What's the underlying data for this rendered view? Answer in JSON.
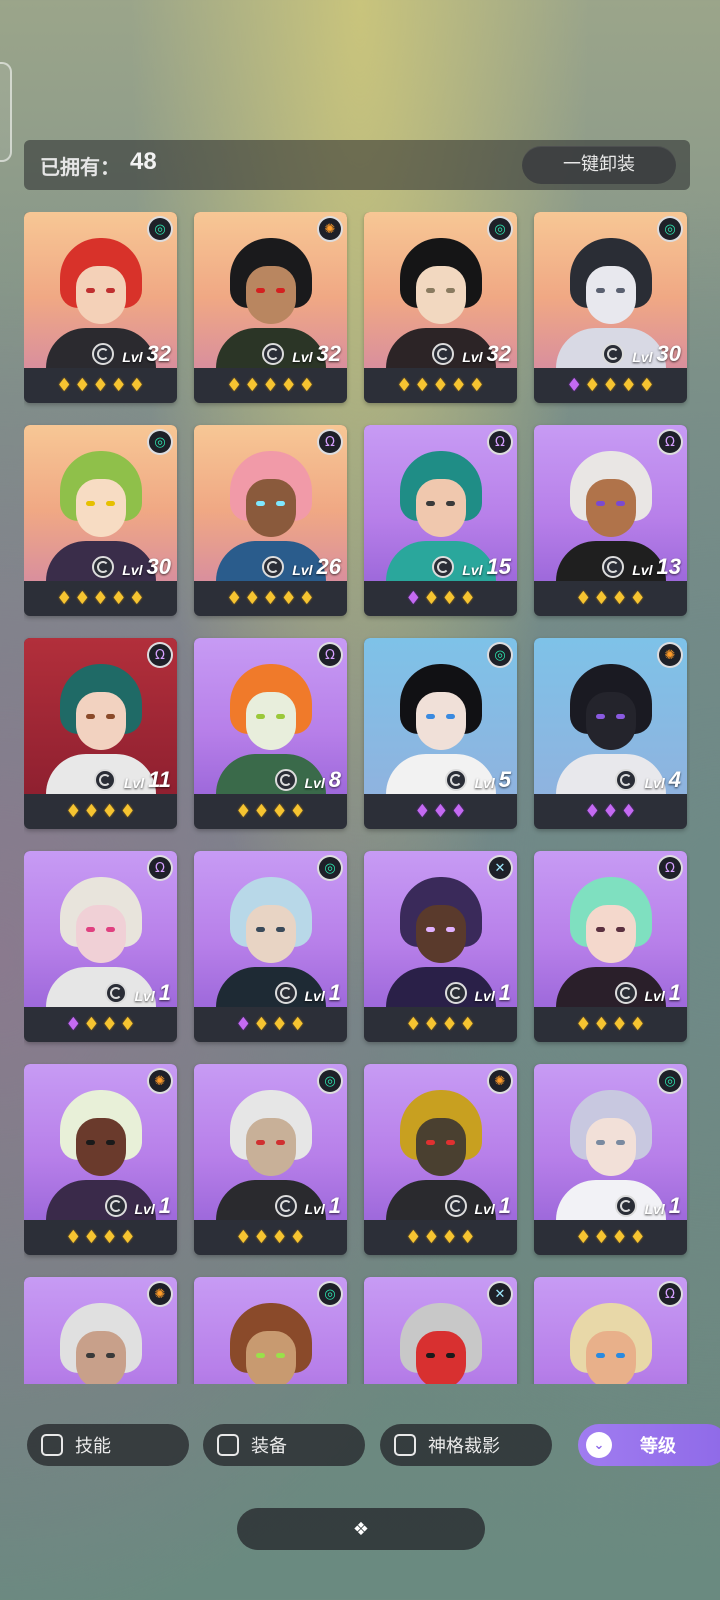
{
  "header": {
    "owned_label": "已拥有：",
    "owned_count": "48",
    "unequip_all_label": "一键卸装"
  },
  "heroes": [
    {
      "level_prefix": "Lvl",
      "level": "32",
      "element": "wind-icon",
      "bg": "orange",
      "hair": "#d8322a",
      "skin": "#f4d1b8",
      "body": "#2b2a2f",
      "eyes": "#c03030",
      "gems": [
        "gold",
        "gold",
        "gold",
        "gold",
        "gold"
      ]
    },
    {
      "level_prefix": "Lvl",
      "level": "32",
      "element": "sun-icon",
      "bg": "orange",
      "hair": "#1a1a1c",
      "skin": "#b98660",
      "body": "#2b3526",
      "eyes": "#d42020",
      "gems": [
        "gold",
        "gold",
        "gold",
        "gold",
        "gold"
      ]
    },
    {
      "level_prefix": "Lvl",
      "level": "32",
      "element": "wind-icon",
      "bg": "orange",
      "hair": "#151516",
      "skin": "#f2d8c0",
      "body": "#2c2426",
      "eyes": "#8a7b60",
      "gems": [
        "gold",
        "gold",
        "gold",
        "gold",
        "gold"
      ]
    },
    {
      "level_prefix": "Lvl",
      "level": "30",
      "element": "wind-icon",
      "bg": "orange",
      "hair": "#2a2d35",
      "skin": "#e8e8ee",
      "body": "#d8d9e4",
      "eyes": "#5a6070",
      "gems": [
        "purple",
        "gold",
        "gold",
        "gold",
        "gold"
      ]
    },
    {
      "level_prefix": "Lvl",
      "level": "30",
      "element": "wind-icon",
      "bg": "orange",
      "hair": "#8fc04a",
      "skin": "#f7dcc3",
      "body": "#3a2d4a",
      "eyes": "#e6c000",
      "gems": [
        "gold",
        "gold",
        "gold",
        "gold",
        "gold"
      ]
    },
    {
      "level_prefix": "Lvl",
      "level": "26",
      "element": "void-icon",
      "bg": "orange",
      "hair": "#f19aa8",
      "skin": "#8a5a3c",
      "body": "#2a5c8c",
      "eyes": "#7fe8ff",
      "gems": [
        "gold",
        "gold",
        "gold",
        "gold",
        "gold"
      ]
    },
    {
      "level_prefix": "Lvl",
      "level": "15",
      "element": "void-icon",
      "bg": "purple",
      "hair": "#1f8d86",
      "skin": "#f0c8ae",
      "body": "#2aa79c",
      "eyes": "#3a3a3a",
      "gems": [
        "purple",
        "gold",
        "gold",
        "gold"
      ]
    },
    {
      "level_prefix": "Lvl",
      "level": "13",
      "element": "void-icon",
      "bg": "purple",
      "hair": "#e9e6e4",
      "skin": "#b0734a",
      "body": "#1f1f1f",
      "eyes": "#7a4ad0",
      "gems": [
        "gold",
        "gold",
        "gold",
        "gold"
      ]
    },
    {
      "level_prefix": "Lvl",
      "level": "11",
      "element": "void-icon",
      "bg": "red",
      "hair": "#1f6a66",
      "skin": "#f2d2c0",
      "body": "#e8e8e8",
      "eyes": "#8a4a2a",
      "gems": [
        "gold",
        "gold",
        "gold",
        "gold"
      ]
    },
    {
      "level_prefix": "Lvl",
      "level": "8",
      "element": "void-icon",
      "bg": "purple",
      "hair": "#f07a2a",
      "skin": "#e8eedc",
      "body": "#3a6a4a",
      "eyes": "#9ac83a",
      "gems": [
        "gold",
        "gold",
        "gold",
        "gold"
      ]
    },
    {
      "level_prefix": "Lvl",
      "level": "5",
      "element": "wind-icon",
      "bg": "sky",
      "hair": "#111114",
      "skin": "#f0e0d8",
      "body": "#f2f2f2",
      "eyes": "#3a8ae0",
      "gems": [
        "purple",
        "purple",
        "purple"
      ]
    },
    {
      "level_prefix": "Lvl",
      "level": "4",
      "element": "sun-icon",
      "bg": "sky",
      "hair": "#1a1a22",
      "skin": "#24242c",
      "body": "#e8e8ec",
      "eyes": "#8a5ae0",
      "gems": [
        "purple",
        "purple",
        "purple"
      ]
    },
    {
      "level_prefix": "Lvl",
      "level": "1",
      "element": "void-icon",
      "bg": "purple",
      "hair": "#e8e4dc",
      "skin": "#f0d0d6",
      "body": "#e6e6e6",
      "eyes": "#e04080",
      "gems": [
        "purple",
        "gold",
        "gold",
        "gold"
      ]
    },
    {
      "level_prefix": "Lvl",
      "level": "1",
      "element": "wind-icon",
      "bg": "purple",
      "hair": "#b8d8e8",
      "skin": "#e8d4c4",
      "body": "#1e2a34",
      "eyes": "#3a4a5a",
      "gems": [
        "purple",
        "gold",
        "gold",
        "gold"
      ]
    },
    {
      "level_prefix": "Lvl",
      "level": "1",
      "element": "cross-icon",
      "bg": "purple",
      "hair": "#3a2a5a",
      "skin": "#5a3a2c",
      "body": "#2a2048",
      "eyes": "#e0b0ff",
      "gems": [
        "gold",
        "gold",
        "gold",
        "gold"
      ]
    },
    {
      "level_prefix": "Lvl",
      "level": "1",
      "element": "void-icon",
      "bg": "purple",
      "hair": "#7fe0c0",
      "skin": "#f4d8cc",
      "body": "#2a1f2a",
      "eyes": "#5a3040",
      "gems": [
        "gold",
        "gold",
        "gold",
        "gold"
      ]
    },
    {
      "level_prefix": "Lvl",
      "level": "1",
      "element": "sun-icon",
      "bg": "purple",
      "hair": "#e8f0d8",
      "skin": "#6a3a2c",
      "body": "#3a2a4a",
      "eyes": "#1a1a1a",
      "gems": [
        "gold",
        "gold",
        "gold",
        "gold"
      ]
    },
    {
      "level_prefix": "Lvl",
      "level": "1",
      "element": "wind-icon",
      "bg": "purple",
      "hair": "#e6e6e6",
      "skin": "#c8b098",
      "body": "#2a2a2e",
      "eyes": "#d03030",
      "gems": [
        "gold",
        "gold",
        "gold",
        "gold"
      ]
    },
    {
      "level_prefix": "Lvl",
      "level": "1",
      "element": "sun-icon",
      "bg": "purple",
      "hair": "#c8a020",
      "skin": "#4a4030",
      "body": "#2a2a2e",
      "eyes": "#e03030",
      "gems": [
        "gold",
        "gold",
        "gold",
        "gold"
      ]
    },
    {
      "level_prefix": "Lvl",
      "level": "1",
      "element": "wind-icon",
      "bg": "purple",
      "hair": "#c8c8e0",
      "skin": "#f2e0d8",
      "body": "#f2f2f6",
      "eyes": "#7a8aa0",
      "gems": [
        "gold",
        "gold",
        "gold",
        "gold"
      ]
    },
    {
      "level_prefix": "",
      "level": "",
      "element": "sun-icon",
      "bg": "purple",
      "hair": "#e0e0e0",
      "skin": "#c8a08a",
      "body": "#1e1e22",
      "eyes": "#3a3a3a",
      "gems": []
    },
    {
      "level_prefix": "",
      "level": "",
      "element": "wind-icon",
      "bg": "purple",
      "hair": "#8a4a2a",
      "skin": "#c89a70",
      "body": "#3a3a3a",
      "eyes": "#9ae04a",
      "gems": []
    },
    {
      "level_prefix": "",
      "level": "",
      "element": "cross-icon",
      "bg": "purple",
      "hair": "#c8c8c8",
      "skin": "#d83030",
      "body": "#1e1e22",
      "eyes": "#1a1a1a",
      "gems": []
    },
    {
      "level_prefix": "",
      "level": "",
      "element": "void-icon",
      "bg": "purple",
      "hair": "#e8d8a8",
      "skin": "#e8b08a",
      "body": "#2a2a2a",
      "eyes": "#2a8ae0",
      "gems": []
    }
  ],
  "filters": {
    "skill_label": "技能",
    "equipment_label": "装备",
    "divine_label": "神格裁影",
    "level_sort_label": "等级"
  },
  "bottom": {
    "expand_glyph": "❖"
  },
  "colors": {
    "gem_gold": "#f6c431",
    "gem_purple": "#c46af2",
    "accent_purple": "#9a76ee"
  }
}
